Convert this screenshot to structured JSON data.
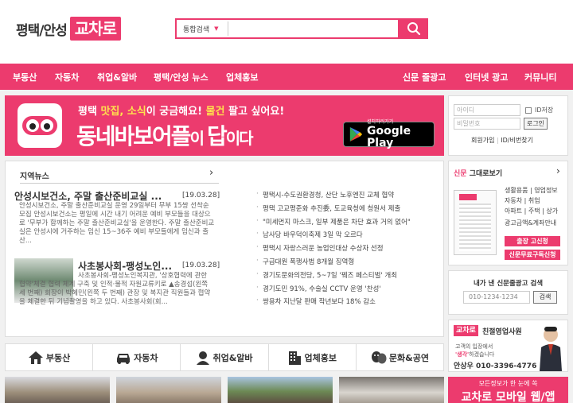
{
  "header": {
    "logo_left": "평택/안성",
    "logo_right": "교차로",
    "search_scope": "통합검색",
    "search_placeholder": "",
    "search_icon": "search-icon"
  },
  "nav": {
    "items": [
      "부동산",
      "자동차",
      "취업&알바",
      "평택/안성 뉴스",
      "업체홍보"
    ],
    "right_items": [
      "신문 줄광고",
      "인터넷 광고",
      "커뮤니티"
    ]
  },
  "banner": {
    "line1_a": "평택 ",
    "line1_b": "맛집, 소식",
    "line1_c": "이 궁금해요! ",
    "line1_d": "물건",
    "line1_e": " 팔고 싶어요!",
    "line2_a": "동네바보어플",
    "line2_b": "이 ",
    "line2_c": "답",
    "line2_d": "이다",
    "store_small": "설치하러가기",
    "store_big": "Google Play"
  },
  "login": {
    "id_placeholder": "아이디",
    "pw_placeholder": "비밀번호",
    "save_id": "ID저장",
    "login_button": "로그인",
    "join": "회원가입",
    "find": "ID/비번찾기"
  },
  "news": {
    "heading": "지역뉴스",
    "articles": [
      {
        "title": "안성시보건소, 주말 출산준비교실 ...",
        "date": "[19.03.28]",
        "summary": "안성시보건소, 주말 출산준비교실 운영 29일부터 무부 15쌍 선착순 모집 안성시보건소는 평일에 시간 내기 어려운 예비 부모들을 대상으로 '무부가 함께하는 주말 출산준비교실'을 운영한다. 주말 출산준비교실은 안성시에 거주하는 임신 15~36주 예비 부모들에게 임신과 출산..."
      },
      {
        "title": "사초봉사회-팽성노인...",
        "date": "[19.03.28]",
        "summary": "사초봉사회-팽성노인복지관, '상호협력에 관한 협약'체결 협력 체계 구축 및 인적·물적 자원교류키로 ▲송경섭(왼쪽 세 번째) 회장이 박혜민(왼쪽 두 번째) 관장 및 복지관 직원들과 협약을 체결한 뒤 기념촬영을 하고 있다. 사초봉사회(회..."
      }
    ],
    "headlines": [
      "평택시-수도권환경청, 산단 노후엔진 교체 협약",
      "평택 고교평준화 추진委, 도교육청에 청원서 제출",
      "\"미세먼지 마스크, 일부 제품은 차단 효과 거의 없어\"",
      "남사당 바우덕이축제 3일 막 오르다",
      "평택시 자랑스러운 농업인대상 수상자 선정",
      "구급대원 폭행사범 8개월 징역형",
      "경기도문화의전당, 5~7일 '꿰즈 페스티벌' 개최",
      "경기도민 91%, 수술실 CCTV 운영 '찬성'",
      "쌍용차 지난달 판매 작년보다 18% 감소"
    ]
  },
  "paper": {
    "heading_red": "신문",
    "heading_rest": " 그대로보기",
    "cats": [
      "생활용품 | 영업정보",
      "자동차 | 취업",
      "아파트 | 주택 | 상가",
      "광고금액&계좌안내"
    ],
    "btn1": "출장 고신청",
    "btn2": "신문무료구독신청"
  },
  "adsearch": {
    "heading": "내가 낸 신문줄광고 검색",
    "placeholder": "010-1234-1234",
    "button": "검색"
  },
  "sales": {
    "logo": "교차로",
    "title": "친절영업사원",
    "quote_a": "고객의 입장에서",
    "quote_b": "'생각'",
    "quote_c": "하겠습니다",
    "phone": "안상우 010-3396-4776"
  },
  "tabs": [
    {
      "label": "부동산",
      "icon": "house-icon"
    },
    {
      "label": "자동차",
      "icon": "car-icon"
    },
    {
      "label": "취업&알바",
      "icon": "person-icon"
    },
    {
      "label": "업체홍보",
      "icon": "building-icon"
    },
    {
      "label": "문화&공연",
      "icon": "masks-icon"
    }
  ],
  "mobile": {
    "small": "모든정보가 한 눈에 쏙",
    "big": "교차로 모바일 웹/앱"
  },
  "colors": {
    "brand": "#ec3b6e",
    "yellow": "#ffe14d"
  }
}
